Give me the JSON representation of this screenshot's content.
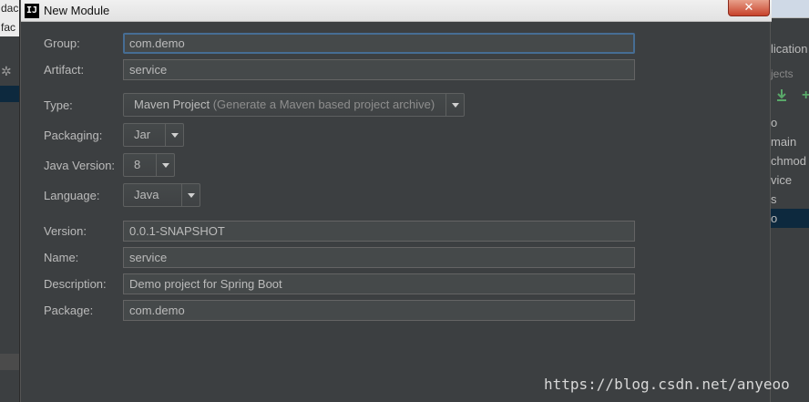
{
  "background": {
    "left_top_text": "dac",
    "left_sub_text": "fac",
    "right_header": "lication",
    "right_projects": "jects",
    "right_tree": [
      "o",
      "main",
      "chmod",
      "vice",
      "s",
      "o"
    ]
  },
  "dialog": {
    "title": "New Module",
    "close_label": "✕"
  },
  "form": {
    "group": {
      "label": "Group:",
      "value": "com.demo"
    },
    "artifact": {
      "label": "Artifact:",
      "value": "service"
    },
    "type": {
      "label": "Type:",
      "value": "Maven Project",
      "hint": "(Generate a Maven based project archive)"
    },
    "packaging": {
      "label": "Packaging:",
      "value": "Jar"
    },
    "java_version": {
      "label": "Java Version:",
      "value": "8"
    },
    "language": {
      "label": "Language:",
      "value": "Java"
    },
    "version": {
      "label": "Version:",
      "value": "0.0.1-SNAPSHOT"
    },
    "name": {
      "label": "Name:",
      "value": "service"
    },
    "description": {
      "label": "Description:",
      "value": "Demo project for Spring Boot"
    },
    "package": {
      "label": "Package:",
      "value": "com.demo"
    }
  },
  "watermark": "https://blog.csdn.net/anyeoo",
  "colors": {
    "dialog_bg": "#3c3f41",
    "field_bg": "#45494a",
    "focus_border": "#466d94",
    "text": "#bbbbbb"
  }
}
